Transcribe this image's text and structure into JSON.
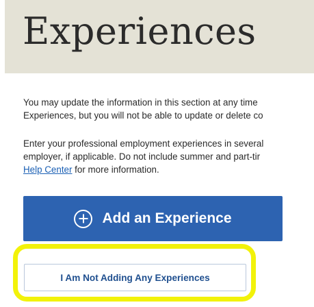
{
  "header": {
    "title": "Experiences"
  },
  "intro": {
    "lines": [
      "You may update the information in this section at any time",
      "Experiences, but you will not be able to update or delete co"
    ]
  },
  "instructions": {
    "lines": [
      "Enter your professional employment experiences in several",
      "employer, if applicable. Do not include summer and part-tir"
    ],
    "help_link": "Help Center",
    "after_link": " for more information."
  },
  "actions": {
    "add_label": "Add an Experience",
    "not_adding_label": "I Am Not Adding Any Experiences"
  },
  "colors": {
    "header_band": "#e4e2d6",
    "primary_button": "#2d63b1",
    "highlight": "#f2f20a",
    "link": "#1a5fb4"
  },
  "icons": {
    "add": "plus-circle-icon"
  }
}
